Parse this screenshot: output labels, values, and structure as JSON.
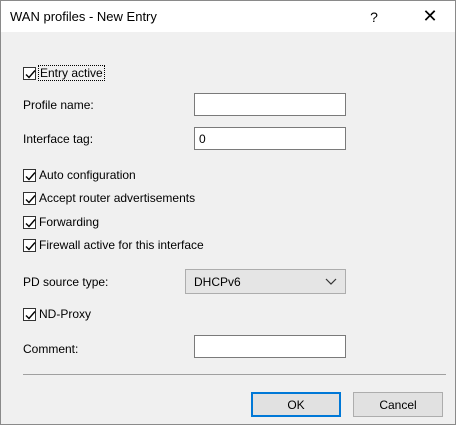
{
  "window": {
    "title": "WAN profiles - New Entry",
    "help_label": "?",
    "close_label": "✕"
  },
  "form": {
    "entry_active": {
      "label": "Entry active",
      "checked": true
    },
    "profile_name": {
      "label": "Profile name:",
      "value": ""
    },
    "interface_tag": {
      "label": "Interface tag:",
      "value": "0"
    },
    "auto_configuration": {
      "label": "Auto configuration",
      "checked": true
    },
    "accept_router_ads": {
      "label": "Accept router advertisements",
      "checked": true
    },
    "forwarding": {
      "label": "Forwarding",
      "checked": true
    },
    "firewall_active": {
      "label": "Firewall active for this interface",
      "checked": true
    },
    "pd_source_type": {
      "label": "PD source type:",
      "value": "DHCPv6"
    },
    "nd_proxy": {
      "label": "ND-Proxy",
      "checked": true
    },
    "comment": {
      "label": "Comment:",
      "value": ""
    }
  },
  "buttons": {
    "ok": "OK",
    "cancel": "Cancel"
  },
  "icons": {
    "check": "checkmark-icon",
    "dropdown": "chevron-down-icon"
  },
  "colors": {
    "default_button_border": "#0078d7"
  }
}
